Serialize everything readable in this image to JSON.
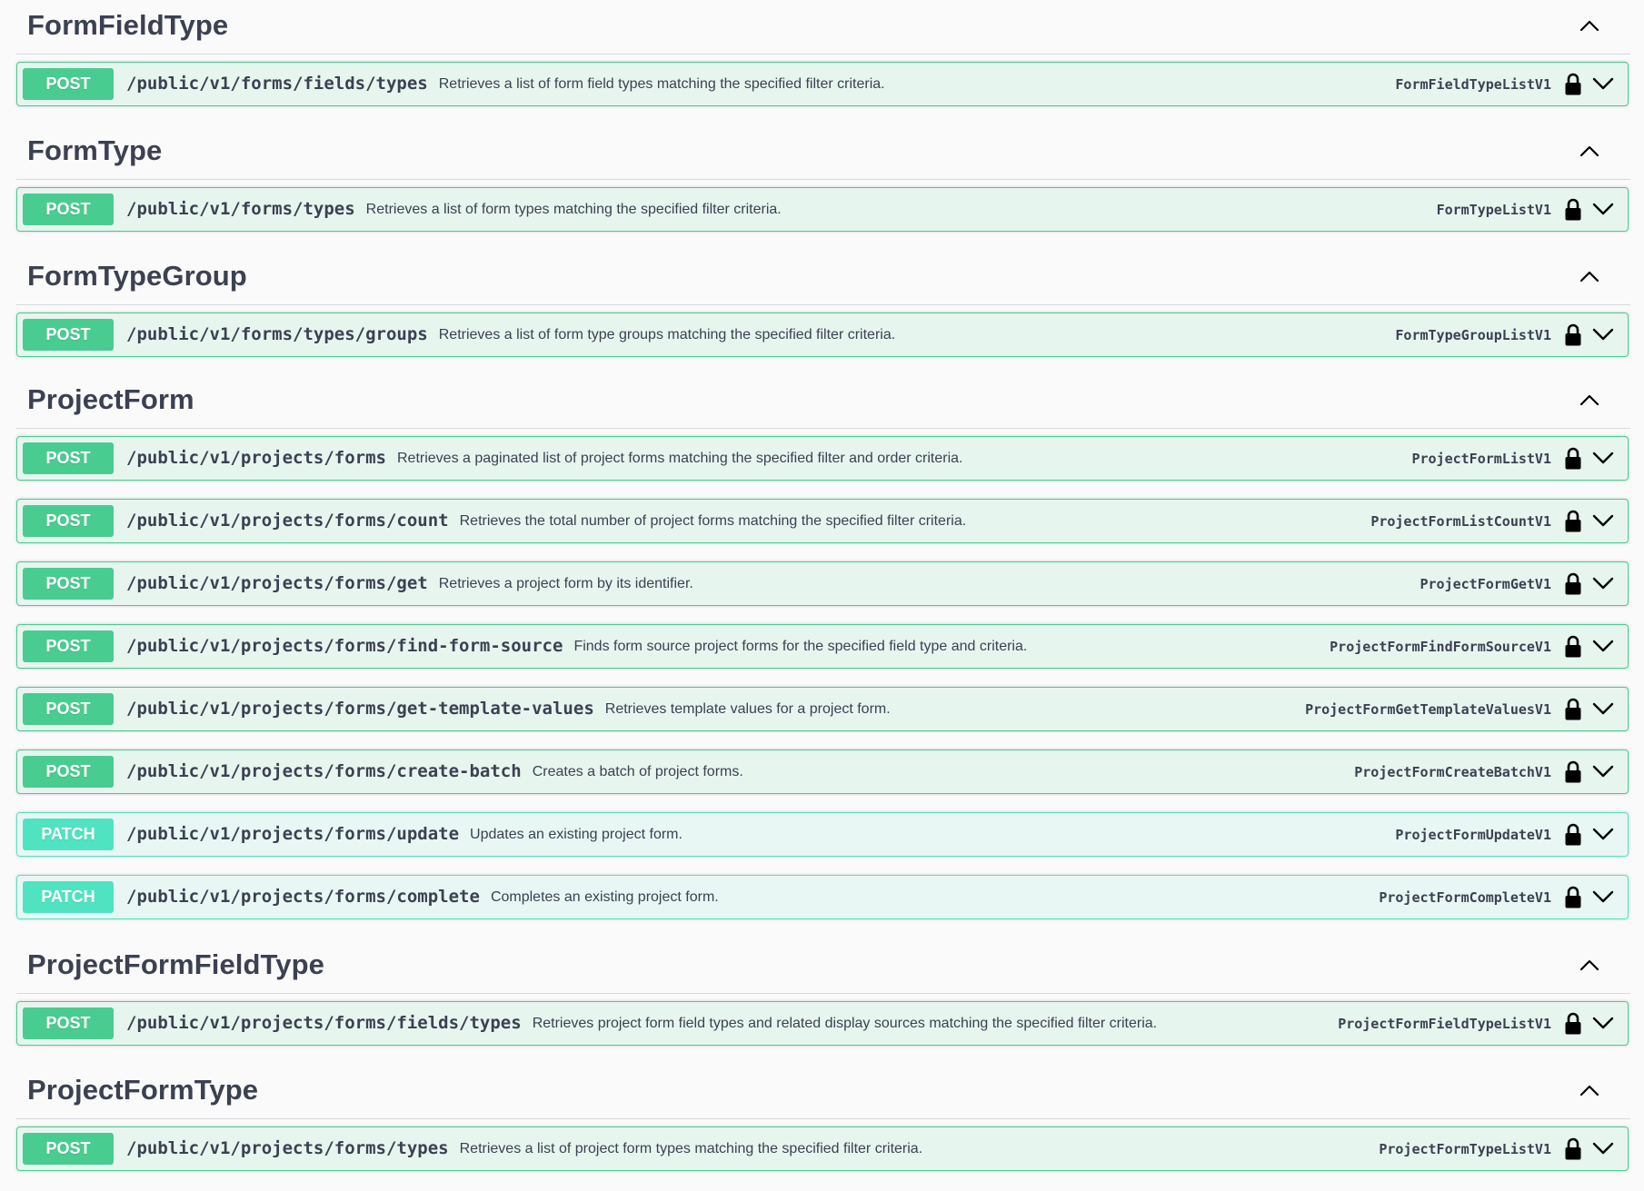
{
  "sections": [
    {
      "title": "FormFieldType",
      "operations": [
        {
          "method": "POST",
          "path": "/public/v1/forms/fields/types",
          "description": "Retrieves a list of form field types matching the specified filter criteria.",
          "operation_id": "FormFieldTypeListV1"
        }
      ]
    },
    {
      "title": "FormType",
      "operations": [
        {
          "method": "POST",
          "path": "/public/v1/forms/types",
          "description": "Retrieves a list of form types matching the specified filter criteria.",
          "operation_id": "FormTypeListV1"
        }
      ]
    },
    {
      "title": "FormTypeGroup",
      "operations": [
        {
          "method": "POST",
          "path": "/public/v1/forms/types/groups",
          "description": "Retrieves a list of form type groups matching the specified filter criteria.",
          "operation_id": "FormTypeGroupListV1"
        }
      ]
    },
    {
      "title": "ProjectForm",
      "operations": [
        {
          "method": "POST",
          "path": "/public/v1/projects/forms",
          "description": "Retrieves a paginated list of project forms matching the specified filter and order criteria.",
          "operation_id": "ProjectFormListV1"
        },
        {
          "method": "POST",
          "path": "/public/v1/projects/forms/count",
          "description": "Retrieves the total number of project forms matching the specified filter criteria.",
          "operation_id": "ProjectFormListCountV1"
        },
        {
          "method": "POST",
          "path": "/public/v1/projects/forms/get",
          "description": "Retrieves a project form by its identifier.",
          "operation_id": "ProjectFormGetV1"
        },
        {
          "method": "POST",
          "path": "/public/v1/projects/forms/find-form-source",
          "description": "Finds form source project forms for the specified field type and criteria.",
          "operation_id": "ProjectFormFindFormSourceV1"
        },
        {
          "method": "POST",
          "path": "/public/v1/projects/forms/get-template-values",
          "description": "Retrieves template values for a project form.",
          "operation_id": "ProjectFormGetTemplateValuesV1"
        },
        {
          "method": "POST",
          "path": "/public/v1/projects/forms/create-batch",
          "description": "Creates a batch of project forms.",
          "operation_id": "ProjectFormCreateBatchV1"
        },
        {
          "method": "PATCH",
          "path": "/public/v1/projects/forms/update",
          "description": "Updates an existing project form.",
          "operation_id": "ProjectFormUpdateV1"
        },
        {
          "method": "PATCH",
          "path": "/public/v1/projects/forms/complete",
          "description": "Completes an existing project form.",
          "operation_id": "ProjectFormCompleteV1"
        }
      ]
    },
    {
      "title": "ProjectFormFieldType",
      "operations": [
        {
          "method": "POST",
          "path": "/public/v1/projects/forms/fields/types",
          "description": "Retrieves project form field types and related display sources matching the specified filter criteria.",
          "operation_id": "ProjectFormFieldTypeListV1"
        }
      ]
    },
    {
      "title": "ProjectFormType",
      "operations": [
        {
          "method": "POST",
          "path": "/public/v1/projects/forms/types",
          "description": "Retrieves a list of project form types matching the specified filter criteria.",
          "operation_id": "ProjectFormTypeListV1"
        }
      ]
    }
  ],
  "icons": {
    "section_toggle": "chevron-up-icon",
    "op_lock": "lock-icon",
    "op_expand": "chevron-down-icon"
  },
  "colors": {
    "post": "#49cc90",
    "patch": "#50e3c2",
    "text": "#3b4151",
    "background": "#fafafa"
  }
}
